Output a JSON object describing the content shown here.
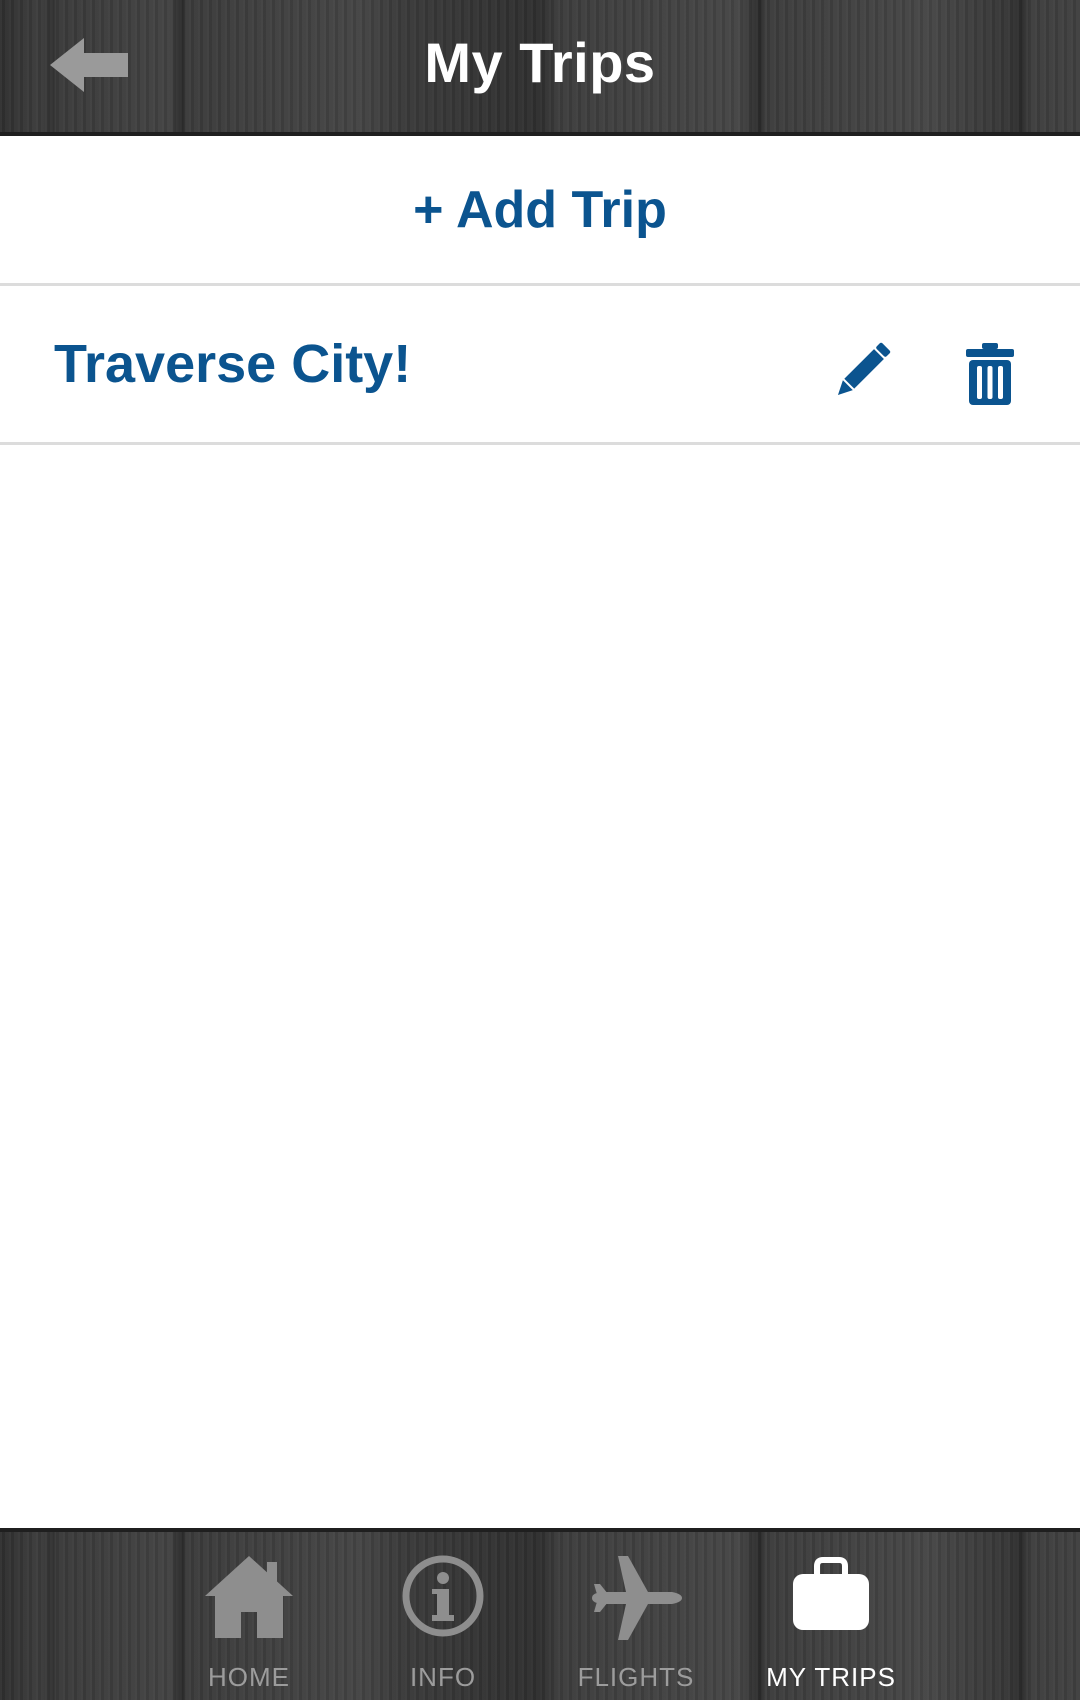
{
  "header": {
    "title": "My Trips",
    "back_icon": "back-arrow-icon"
  },
  "actions": {
    "add_trip_label": "+ Add Trip"
  },
  "trips": [
    {
      "name": "Traverse City!",
      "edit_icon": "pencil-icon",
      "delete_icon": "trash-icon"
    }
  ],
  "bottom_nav": {
    "items": [
      {
        "label": "HOME",
        "icon": "home-icon",
        "active": false
      },
      {
        "label": "INFO",
        "icon": "info-icon",
        "active": false
      },
      {
        "label": "FLIGHTS",
        "icon": "airplane-icon",
        "active": false
      },
      {
        "label": "MY TRIPS",
        "icon": "suitcase-icon",
        "active": true
      }
    ]
  },
  "colors": {
    "accent_blue": "#0b548f",
    "bar_dark": "#3a3a3a",
    "nav_inactive": "#9c9c9c",
    "nav_active": "#ffffff",
    "divider": "#dcdcdc"
  }
}
